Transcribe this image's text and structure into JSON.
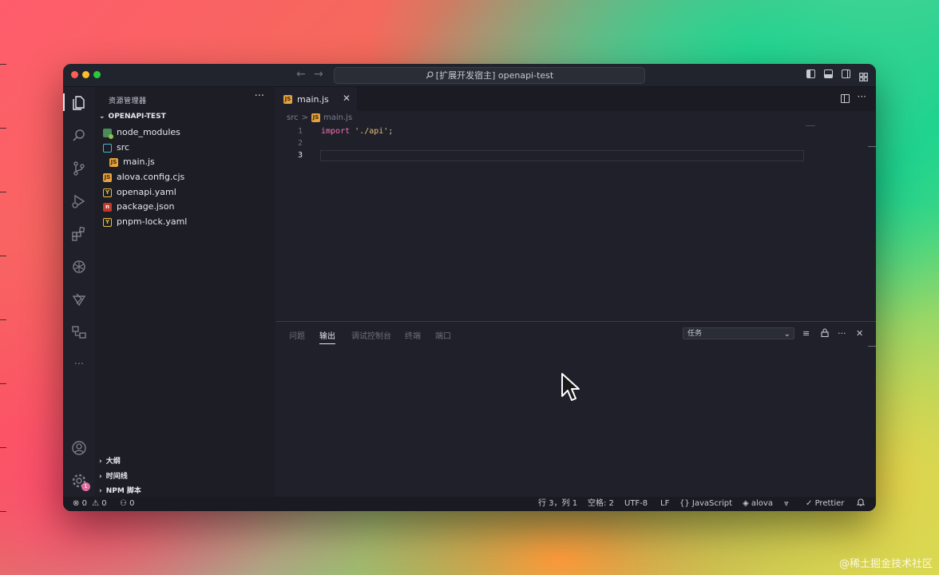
{
  "window": {
    "title": "[扩展开发宿主] openapi-test",
    "nav_back": "←",
    "nav_forward": "→"
  },
  "sidebar": {
    "title": "资源管理器",
    "more": "···",
    "root": "OPENAPI-TEST",
    "tree": [
      {
        "label": "node_modules",
        "icon": "folder-node-icon",
        "indent": 0
      },
      {
        "label": "src",
        "icon": "folder-src-icon",
        "indent": 0
      },
      {
        "label": "main.js",
        "icon": "js-file-icon",
        "indent": 1
      },
      {
        "label": "alova.config.cjs",
        "icon": "js-file-icon",
        "indent": 0
      },
      {
        "label": "openapi.yaml",
        "icon": "yaml-file-icon",
        "indent": 0
      },
      {
        "label": "package.json",
        "icon": "npm-file-icon",
        "indent": 0
      },
      {
        "label": "pnpm-lock.yaml",
        "icon": "yaml-file-icon",
        "indent": 0
      }
    ],
    "sections": [
      "大纲",
      "时间线",
      "NPM 脚本"
    ]
  },
  "editor": {
    "tab_label": "main.js",
    "breadcrumb": [
      "src",
      "main.js"
    ],
    "breadcrumb_sep": ">",
    "lines": [
      {
        "no": "1",
        "keyword": "import",
        "string": "'./api'",
        "tail": ";"
      },
      {
        "no": "2",
        "keyword": "",
        "string": "",
        "tail": ""
      },
      {
        "no": "3",
        "keyword": "",
        "string": "",
        "tail": ""
      }
    ]
  },
  "panel": {
    "tabs": [
      "问题",
      "输出",
      "调试控制台",
      "终端",
      "端口"
    ],
    "active_tab": "输出",
    "task_select": "任务"
  },
  "statusbar": {
    "errors": "0",
    "warnings": "0",
    "ports": "0",
    "position": "行 3，列 1",
    "spaces": "空格: 2",
    "encoding": "UTF-8",
    "eol": "LF",
    "language": "JavaScript",
    "alova": "alova",
    "prettier": "Prettier"
  },
  "badges": {
    "settings_count": "1"
  },
  "watermark": "@稀土掘金技术社区",
  "colors": {
    "keyword": "#f472b6",
    "string": "#e6c07b",
    "accent_tab": "#e6e7ec"
  }
}
